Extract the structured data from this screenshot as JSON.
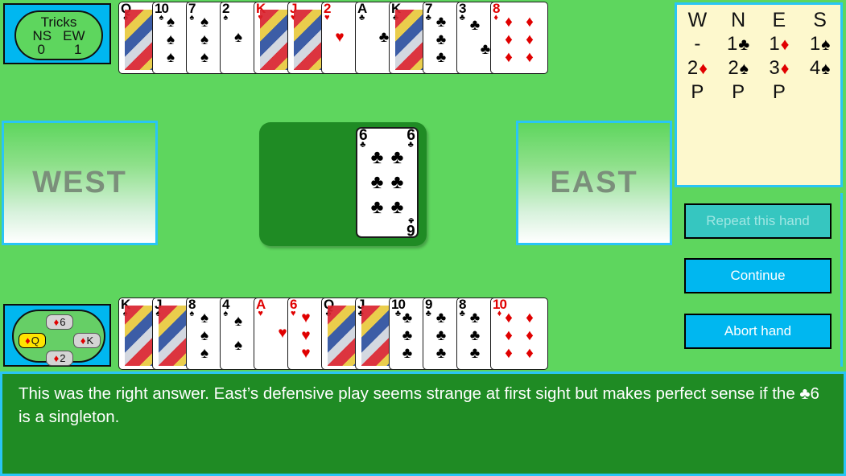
{
  "tricks": {
    "title": "Tricks",
    "ns_label": "NS",
    "ew_label": "EW",
    "ns_value": "0",
    "ew_value": "1"
  },
  "seats": {
    "west_label": "WEST",
    "east_label": "EAST"
  },
  "previous_trick": {
    "north": {
      "rank": "6",
      "suit": "♦",
      "color": "#e00000",
      "winner": false
    },
    "west": {
      "rank": "Q",
      "suit": "♦",
      "color": "#e00000",
      "winner": true
    },
    "east": {
      "rank": "K",
      "suit": "♦",
      "color": "#e00000",
      "winner": false
    },
    "south": {
      "rank": "2",
      "suit": "♦",
      "color": "#e00000",
      "winner": false
    }
  },
  "north_hand": [
    {
      "rank": "Q",
      "suit": "♠",
      "color": "blk",
      "face": true
    },
    {
      "rank": "10",
      "suit": "♠",
      "color": "blk",
      "face": false
    },
    {
      "rank": "7",
      "suit": "♠",
      "color": "blk",
      "face": false
    },
    {
      "rank": "2",
      "suit": "♠",
      "color": "blk",
      "face": false
    },
    {
      "rank": "K",
      "suit": "♥",
      "color": "red",
      "face": true
    },
    {
      "rank": "J",
      "suit": "♥",
      "color": "red",
      "face": true
    },
    {
      "rank": "2",
      "suit": "♥",
      "color": "red",
      "face": false
    },
    {
      "rank": "A",
      "suit": "♣",
      "color": "blk",
      "face": false
    },
    {
      "rank": "K",
      "suit": "♣",
      "color": "blk",
      "face": true
    },
    {
      "rank": "7",
      "suit": "♣",
      "color": "blk",
      "face": false
    },
    {
      "rank": "3",
      "suit": "♣",
      "color": "blk",
      "face": false
    },
    {
      "rank": "8",
      "suit": "♦",
      "color": "red",
      "face": false
    }
  ],
  "south_hand": [
    {
      "rank": "K",
      "suit": "♠",
      "color": "blk",
      "face": true
    },
    {
      "rank": "J",
      "suit": "♠",
      "color": "blk",
      "face": true
    },
    {
      "rank": "8",
      "suit": "♠",
      "color": "blk",
      "face": false
    },
    {
      "rank": "4",
      "suit": "♠",
      "color": "blk",
      "face": false
    },
    {
      "rank": "A",
      "suit": "♥",
      "color": "red",
      "face": false
    },
    {
      "rank": "6",
      "suit": "♥",
      "color": "red",
      "face": false
    },
    {
      "rank": "Q",
      "suit": "♣",
      "color": "blk",
      "face": true
    },
    {
      "rank": "J",
      "suit": "♣",
      "color": "blk",
      "face": true
    },
    {
      "rank": "10",
      "suit": "♣",
      "color": "blk",
      "face": false
    },
    {
      "rank": "9",
      "suit": "♣",
      "color": "blk",
      "face": false
    },
    {
      "rank": "8",
      "suit": "♣",
      "color": "blk",
      "face": false
    },
    {
      "rank": "10",
      "suit": "♦",
      "color": "red",
      "face": false
    }
  ],
  "trick_card": {
    "rank": "6",
    "suit": "♣",
    "color": "blk",
    "count": 6
  },
  "bidding": {
    "headers": [
      "W",
      "N",
      "E",
      "S"
    ],
    "rows": [
      [
        {
          "level": "-",
          "suit": "",
          "color": "blk"
        },
        {
          "level": "1",
          "suit": "♣",
          "color": "blk"
        },
        {
          "level": "1",
          "suit": "♦",
          "color": "red"
        },
        {
          "level": "1",
          "suit": "♠",
          "color": "blk"
        }
      ],
      [
        {
          "level": "2",
          "suit": "♦",
          "color": "red"
        },
        {
          "level": "2",
          "suit": "♠",
          "color": "blk"
        },
        {
          "level": "3",
          "suit": "♦",
          "color": "red"
        },
        {
          "level": "4",
          "suit": "♠",
          "color": "blk"
        }
      ],
      [
        {
          "level": "P",
          "suit": "",
          "color": "blk"
        },
        {
          "level": "P",
          "suit": "",
          "color": "blk"
        },
        {
          "level": "P",
          "suit": "",
          "color": "blk"
        },
        {
          "level": "",
          "suit": "",
          "color": "blk"
        }
      ]
    ]
  },
  "buttons": {
    "repeat": "Repeat this hand",
    "continue": "Continue",
    "abort": "Abort hand"
  },
  "message": {
    "part1": "This was the right answer. East’s defensive play seems strange at first sight but makes perfect sense if the ",
    "suit": "♣",
    "part2": "6 is a singleton."
  },
  "colors": {
    "table_green": "#5ed65e",
    "dark_green": "#1f8b24",
    "cyan": "#29c5f6",
    "button_blue": "#00b7f0",
    "button_disabled": "#36c6c0",
    "bid_cream": "#fdf8cd",
    "red_suit": "#e00000"
  }
}
